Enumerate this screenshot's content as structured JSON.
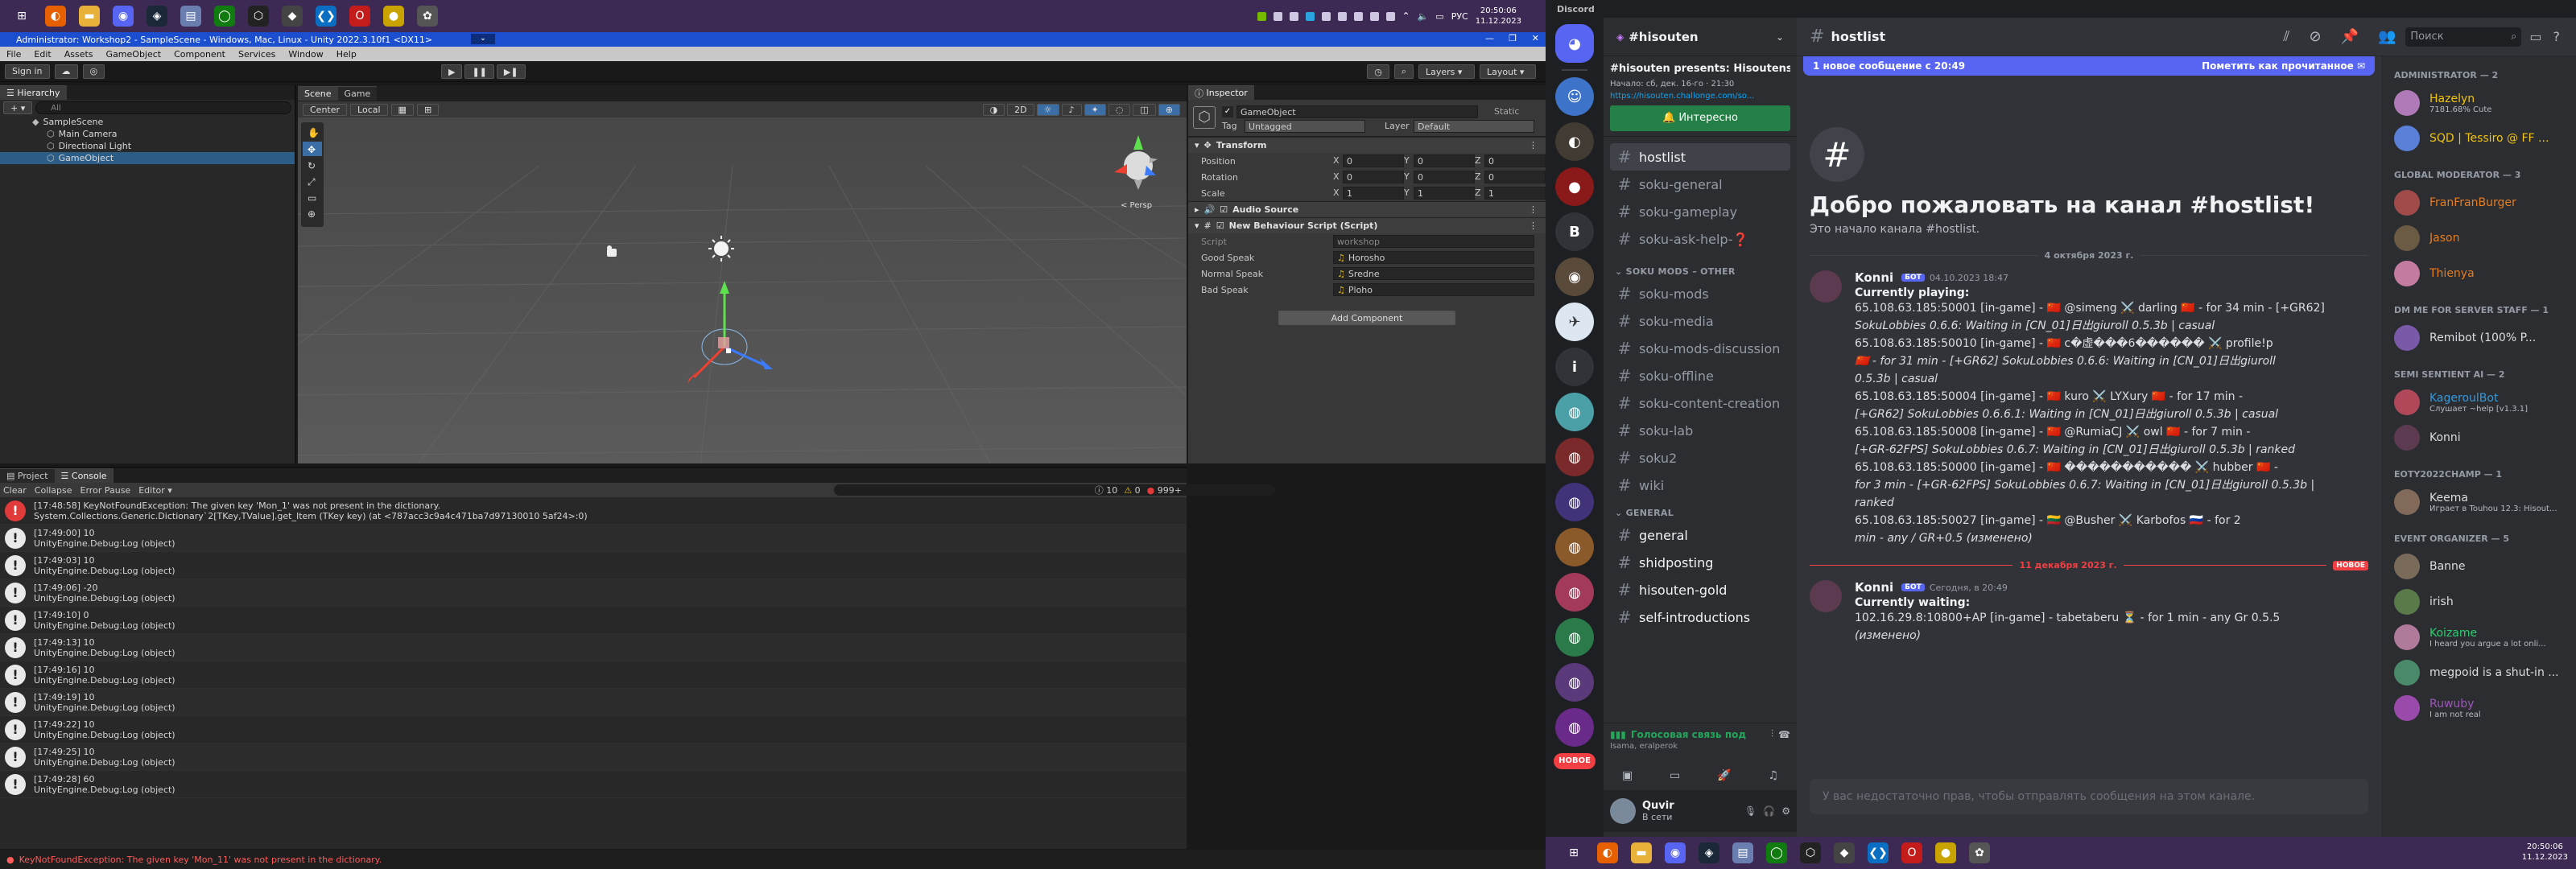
{
  "colors": {
    "discord_blurple": "#5865f2",
    "unity_title": "#1b4fcf",
    "taskbar": "#3c2a55",
    "green": "#248046",
    "error": "#ff5c5c"
  },
  "top_taskbar": {
    "lang": "РУС",
    "time": "20:50:06",
    "date": "11.12.2023",
    "apps": [
      {
        "name": "start-icon",
        "glyph": "⊞",
        "bg": "#3c2a55"
      },
      {
        "name": "firefox-icon",
        "glyph": "◐",
        "bg": "#e66000"
      },
      {
        "name": "explorer-icon",
        "glyph": "▬",
        "bg": "#e8b23a"
      },
      {
        "name": "discord-app-icon",
        "glyph": "◉",
        "bg": "#5865f2"
      },
      {
        "name": "steam-icon",
        "glyph": "◈",
        "bg": "#1b2838"
      },
      {
        "name": "files-icon",
        "glyph": "▤",
        "bg": "#6a7fb0"
      },
      {
        "name": "xbox-icon",
        "glyph": "◯",
        "bg": "#107c10"
      },
      {
        "name": "unity-hub-icon",
        "glyph": "⬡",
        "bg": "#222"
      },
      {
        "name": "unity-icon",
        "glyph": "◆",
        "bg": "#444"
      },
      {
        "name": "vscode-icon",
        "glyph": "❮❯",
        "bg": "#0a6fc2"
      },
      {
        "name": "opera-icon",
        "glyph": "O",
        "bg": "#c41b1b"
      },
      {
        "name": "osu-icon",
        "glyph": "●",
        "bg": "#c9a400"
      },
      {
        "name": "misc-app-icon",
        "glyph": "✿",
        "bg": "#555"
      }
    ]
  },
  "unity": {
    "title": "Administrator: Workshop2 - SampleScene - Windows, Mac, Linux - Unity 2022.3.10f1 <DX11>",
    "menu": [
      "File",
      "Edit",
      "Assets",
      "GameObject",
      "Component",
      "Services",
      "Window",
      "Help"
    ],
    "toolbar": {
      "sign_in": "Sign in",
      "layers": "Layers",
      "layout": "Layout"
    },
    "hierarchy": {
      "tab": "Hierarchy",
      "search_placeholder": "All",
      "items": [
        {
          "label": "SampleScene",
          "indent": 0
        },
        {
          "label": "Main Camera",
          "indent": 1
        },
        {
          "label": "Directional Light",
          "indent": 1
        },
        {
          "label": "GameObject",
          "indent": 1
        }
      ]
    },
    "scene": {
      "tab_scene": "Scene",
      "tab_game": "Game",
      "pivot": "Center",
      "space": "Local",
      "mode2d": "2D",
      "persp": "< Persp"
    },
    "inspector": {
      "tab": "Inspector",
      "object_name": "GameObject",
      "static_label": "Static",
      "tag_label": "Tag",
      "tag": "Untagged",
      "layer_label": "Layer",
      "layer": "Default",
      "transform": "Transform",
      "position": "Position",
      "rotation": "Rotation",
      "scale": "Scale",
      "pos": [
        "0",
        "0",
        "0"
      ],
      "rot": [
        "0",
        "0",
        "0"
      ],
      "scl": [
        "1",
        "1",
        "1"
      ],
      "audio": "Audio Source",
      "script_comp": "New Behaviour Script (Script)",
      "script_label": "Script",
      "script_val": "workshop",
      "fields": [
        {
          "label": "Good Speak",
          "value": "Horosho"
        },
        {
          "label": "Normal Speak",
          "value": "Sredne"
        },
        {
          "label": "Bad Speak",
          "value": "Ploho"
        }
      ],
      "add_component": "Add Component"
    },
    "console": {
      "tab_project": "Project",
      "tab_console": "Console",
      "clear": "Clear",
      "collapse": "Collapse",
      "error_pause": "Error Pause",
      "editor": "Editor",
      "count_info": "10",
      "count_warn": "0",
      "count_err": "999+",
      "logs": [
        {
          "type": "err",
          "l1": "[17:48:58] KeyNotFoundException: The given key 'Mon_1' was not present in the dictionary.",
          "l2": "System.Collections.Generic.Dictionary`2[TKey,TValue].get_Item (TKey key) (at <787acc3c9a4c471ba7d97130010 5af24>:0)"
        },
        {
          "type": "log",
          "l1": "[17:49:00] 10",
          "l2": "UnityEngine.Debug:Log (object)"
        },
        {
          "type": "log",
          "l1": "[17:49:03] 10",
          "l2": "UnityEngine.Debug:Log (object)"
        },
        {
          "type": "log",
          "l1": "[17:49:06] -20",
          "l2": "UnityEngine.Debug:Log (object)"
        },
        {
          "type": "log",
          "l1": "[17:49:10] 0",
          "l2": "UnityEngine.Debug:Log (object)"
        },
        {
          "type": "log",
          "l1": "[17:49:13] 10",
          "l2": "UnityEngine.Debug:Log (object)"
        },
        {
          "type": "log",
          "l1": "[17:49:16] 10",
          "l2": "UnityEngine.Debug:Log (object)"
        },
        {
          "type": "log",
          "l1": "[17:49:19] 10",
          "l2": "UnityEngine.Debug:Log (object)"
        },
        {
          "type": "log",
          "l1": "[17:49:22] 10",
          "l2": "UnityEngine.Debug:Log (object)"
        },
        {
          "type": "log",
          "l1": "[17:49:25] 10",
          "l2": "UnityEngine.Debug:Log (object)"
        },
        {
          "type": "log",
          "l1": "[17:49:28] 60",
          "l2": "UnityEngine.Debug:Log (object)"
        }
      ]
    },
    "status": "KeyNotFoundException: The given key 'Mon_11' was not present in the dictionary."
  },
  "discord": {
    "app_title": "Discord",
    "server": "#hisouten",
    "event_title": "#hisouten presents: Hisoutensol",
    "event_time": "Начало: сб, дек. 16-го · 21:30",
    "event_link": "https://hisouten.challonge.com/so...",
    "interested": "Интересно",
    "channels_top": [
      {
        "label": "hostlist",
        "sel": true
      },
      {
        "label": "soku-general",
        "sel": false
      },
      {
        "label": "soku-gameplay",
        "sel": false
      },
      {
        "label": "soku-ask-help-❓",
        "sel": false
      }
    ],
    "cat_other": "SOKU MODS – OTHER",
    "channels_other": [
      "soku-mods",
      "soku-media",
      "soku-mods-discussion",
      "soku-offline",
      "soku-content-creation",
      "soku-lab",
      "soku2",
      "wiki"
    ],
    "cat_general": "GENERAL",
    "channels_general": [
      "general",
      "shidposting",
      "hisouten-gold",
      "self-introductions"
    ],
    "voice_status": "Голосовая связь под",
    "voice_sub": "Isama, eralperok",
    "user_name": "Quvir",
    "user_status": "В сети",
    "guild_new": "НОВОЕ",
    "header_channel": "hostlist",
    "search_placeholder": "Поиск",
    "new_msgs": "1 новое сообщение с 20:49",
    "mark_read": "Пометить как прочитанное",
    "welcome_title": "Добро пожаловать на канал #hostlist!",
    "welcome_sub": "Это начало канала #hostlist.",
    "date1": "4 октября 2023 г.",
    "date2": "11 декабря 2023 г.",
    "date2_badge": "НОВОЕ",
    "bot_tag": "БОТ",
    "msg1": {
      "author": "Konni",
      "time": "04.10.2023 18:47",
      "heading": "Currently playing:",
      "lines": [
        "65.108.63.185:50001 [in-game] - 🇨🇳 @simeng ⚔️ darling 🇨🇳 - for 34 min - [+GR62]",
        "SokuLobbies 0.6.6: Waiting in [CN_01]日出giuroll 0.5.3b | casual",
        "65.108.63.185:50010 [in-game] - 🇨🇳 c�虚���6������ ⚔️ profile!p",
        "🇨🇳 - for 31 min - [+GR62] SokuLobbies 0.6.6: Waiting in [CN_01]日出giuroll",
        "0.5.3b | casual",
        "65.108.63.185:50004 [in-game] - 🇨🇳 kuro ⚔️ LYXury 🇨🇳 - for 17 min -",
        "[+GR62] SokuLobbies 0.6.6.1: Waiting in [CN_01]日出giuroll 0.5.3b | casual",
        "65.108.63.185:50008 [in-game] - 🇨🇳 @RumiaCJ ⚔️ owl 🇨🇳 - for 7 min -",
        "[+GR-62FPS] SokuLobbies 0.6.7: Waiting in [CN_01]日出giuroll 0.5.3b | ranked",
        "65.108.63.185:50000 [in-game] - 🇨🇳 ����������� ⚔️ hubber 🇨🇳 -",
        "for 3 min - [+GR-62FPS] SokuLobbies 0.6.7: Waiting in [CN_01]日出giuroll 0.5.3b |",
        "ranked",
        "65.108.63.185:50027 [in-game] - 🇱🇹 @Busher ⚔️ Karbofos 🇷🇺 - for 2",
        "min - any / GR+0.5 (изменено)"
      ]
    },
    "msg2": {
      "author": "Konni",
      "time": "Сегодня, в 20:49",
      "heading": "Currently waiting:",
      "lines": [
        "102.16.29.8:10800+AP [in-game] - tabetaberu ⏳ - for 1 min - any Gr 0.5.5",
        "(изменено)"
      ]
    },
    "input_placeholder": "У вас недостаточно прав, чтобы отправлять сообщения на этом канале.",
    "member_groups": [
      {
        "title": "ADMINISTRATOR — 2",
        "members": [
          {
            "name": "Hazelyn",
            "sub": "7181.68% Cute",
            "color": "#f1c40f",
            "av": "#b07ab9"
          },
          {
            "name": "SQD | Tessiro @ FF ...",
            "sub": "",
            "color": "#f1c40f",
            "av": "#5a7fd6"
          }
        ]
      },
      {
        "title": "GLOBAL MODERATOR — 3",
        "members": [
          {
            "name": "FranFranBurger",
            "sub": "",
            "color": "#e67e22",
            "av": "#a04a4a"
          },
          {
            "name": "Jason",
            "sub": "",
            "color": "#e67e22",
            "av": "#6b5a44"
          },
          {
            "name": "Thienya",
            "sub": "",
            "color": "#e67e22",
            "av": "#c47ba0"
          }
        ]
      },
      {
        "title": "DM ME FOR SERVER STAFF — 1",
        "members": [
          {
            "name": "Remibot (100% P...",
            "sub": "",
            "color": "#dbdee1",
            "av": "#7a5aa8"
          }
        ]
      },
      {
        "title": "SEMI SENTIENT AI — 2",
        "members": [
          {
            "name": "KageroulBot",
            "sub": "Слушает ~help [v1.3.1]",
            "color": "#3498db",
            "av": "#b0485a"
          },
          {
            "name": "Konni",
            "sub": "",
            "color": "#dbdee1",
            "av": "#5c3a50"
          }
        ]
      },
      {
        "title": "EOTY2022CHAMP — 1",
        "members": [
          {
            "name": "Keema",
            "sub": "Играет в Touhou 12.3: Hisout...",
            "color": "#dbdee1",
            "av": "#826a5a"
          }
        ]
      },
      {
        "title": "EVENT ORGANIZER — 5",
        "members": [
          {
            "name": "Banne",
            "sub": "",
            "color": "#dbdee1",
            "av": "#7a6a5a"
          },
          {
            "name": "irish",
            "sub": "",
            "color": "#dbdee1",
            "av": "#5a7a4a"
          },
          {
            "name": "Koizame",
            "sub": "I heard you argue a lot onli...",
            "color": "#2ecc71",
            "av": "#b07a9a"
          },
          {
            "name": "megpoid is a shut-in ...",
            "sub": "",
            "color": "#dbdee1",
            "av": "#4a8a6a"
          },
          {
            "name": "Ruwuby",
            "sub": "I am not real",
            "color": "#9b59b6",
            "av": "#9a4aaa"
          }
        ]
      }
    ]
  },
  "bottom_taskbar": {
    "time": "20:50:06",
    "date": "11.12.2023"
  }
}
